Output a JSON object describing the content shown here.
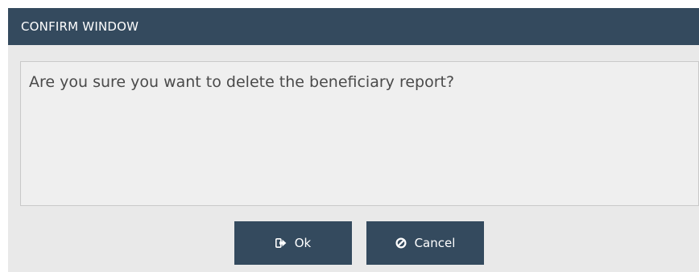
{
  "dialog": {
    "title": "CONFIRM WINDOW",
    "message": "Are you sure you want to delete the beneficiary report?"
  },
  "buttons": {
    "ok_label": "Ok",
    "ok_icon": "sign-out-icon",
    "cancel_label": "Cancel",
    "cancel_icon": "ban-icon"
  },
  "colors": {
    "header_bg": "#344a5e",
    "button_bg": "#344a5e",
    "dialog_bg": "#e9e9e9"
  }
}
